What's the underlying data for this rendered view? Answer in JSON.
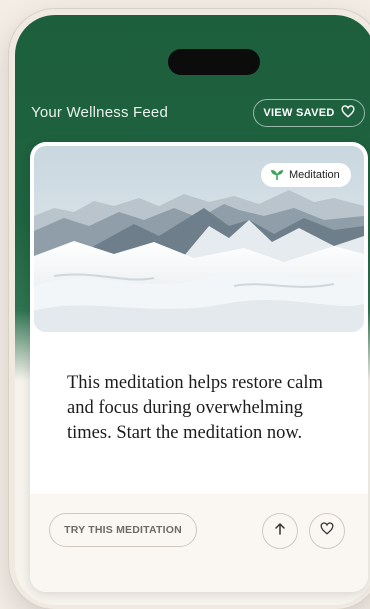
{
  "header": {
    "title": "Your Wellness Feed",
    "view_saved_label": "VIEW SAVED"
  },
  "card": {
    "tag_label": "Meditation",
    "body": "This meditation helps restore calm and focus during overwhelming times. Start the meditation now.",
    "cta_label": "TRY THIS MEDITATION"
  },
  "icons": {
    "saved": "heart-icon",
    "tag": "sprout-icon",
    "upvote": "arrow-up-icon",
    "like": "heart-icon"
  },
  "colors": {
    "header_green": "#1d5f3d",
    "tag_green": "#3aa35b",
    "background": "#f4ede6"
  }
}
